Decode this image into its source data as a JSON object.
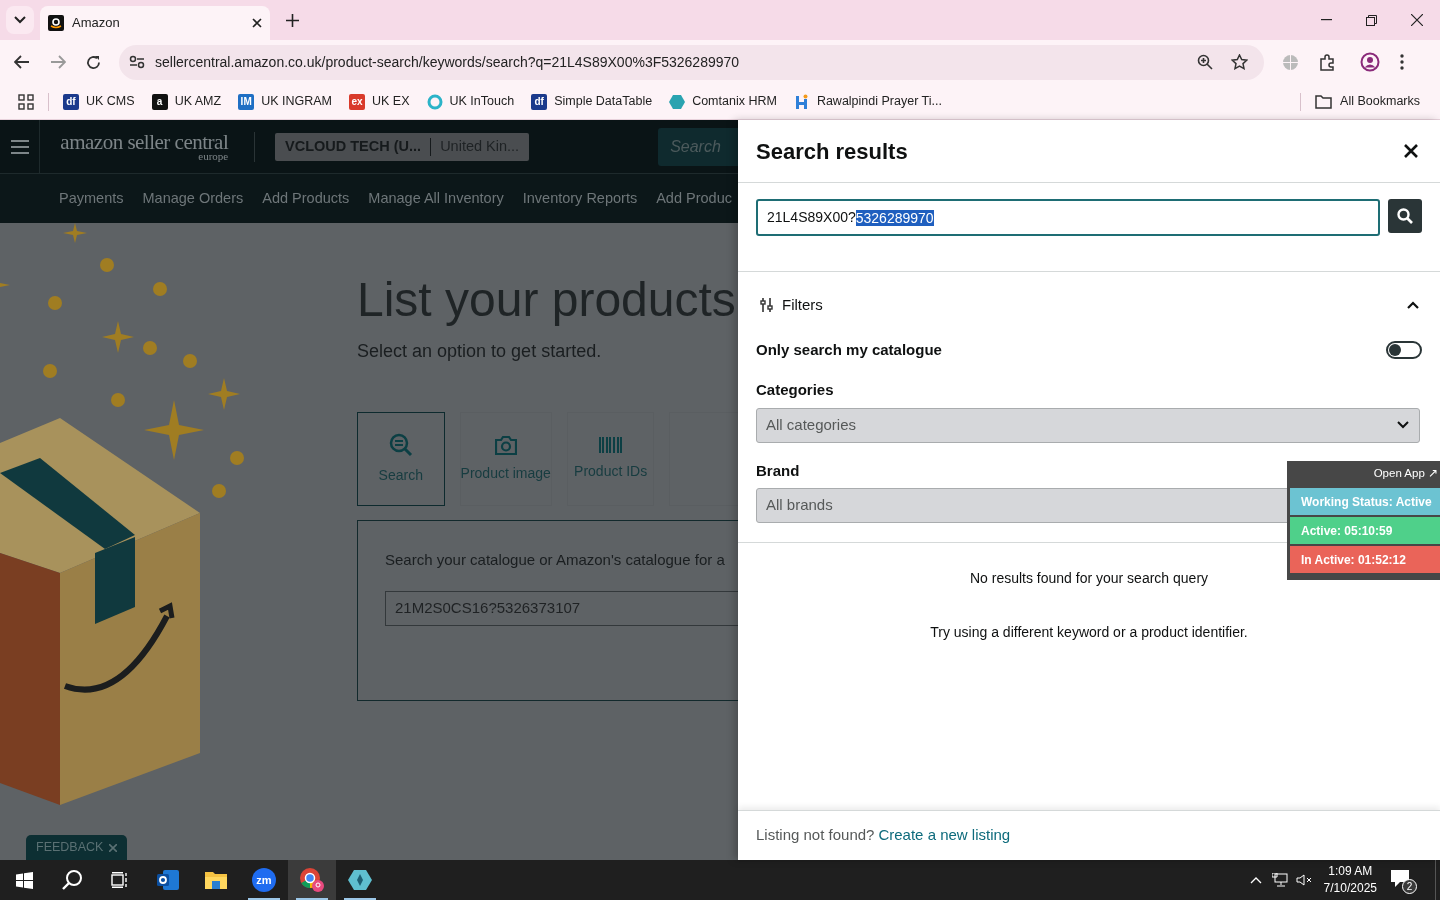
{
  "browser": {
    "tabs": [
      {
        "title": "Amazon",
        "selected": true
      }
    ],
    "url": "sellercentral.amazon.co.uk/product-search/keywords/search?q=21L4S89X00%3F5326289970",
    "bookmarks": [
      {
        "label": "UK CMS",
        "kind": "badge",
        "icon_text": "df",
        "color": "#1b3a8c"
      },
      {
        "label": "UK AMZ",
        "kind": "badge",
        "icon_text": "a",
        "color": "#111111"
      },
      {
        "label": "UK INGRAM",
        "kind": "badge",
        "icon_text": "IM",
        "color": "#1f6fc4"
      },
      {
        "label": "UK EX",
        "kind": "badge",
        "icon_text": "ex",
        "color": "#d93a2b"
      },
      {
        "label": "UK InTouch",
        "kind": "ring",
        "color": "#2bb3c8"
      },
      {
        "label": "Simple DataTable",
        "kind": "badge",
        "icon_text": "df",
        "color": "#1b3a8c"
      },
      {
        "label": "Comtanix HRM",
        "kind": "hex",
        "color": "#2aa3b0"
      },
      {
        "label": "Rawalpindi Prayer Ti...",
        "kind": "figure",
        "color": "#2f7fd8"
      }
    ],
    "all_bookmarks": "All Bookmarks"
  },
  "seller_header": {
    "logo": "amazon seller central",
    "logo_region": "europe",
    "account": "VCLOUD TECH (U...",
    "marketplace": "United Kin...",
    "search_placeholder": "Search"
  },
  "nav": [
    "Payments",
    "Manage Orders",
    "Add Products",
    "Manage All Inventory",
    "Inventory Reports",
    "Add Produc"
  ],
  "page": {
    "title": "List your products",
    "subtitle": "Select an option to get started.",
    "options": [
      {
        "label": "Search",
        "kind": "search",
        "selected": true
      },
      {
        "label": "Product image",
        "kind": "camera",
        "selected": false
      },
      {
        "label": "Product IDs",
        "kind": "barcode",
        "selected": false
      }
    ],
    "prompt": "Search your catalogue or Amazon's catalogue for a",
    "query": "21M2S0CS16?5326373107"
  },
  "feedback": "FEEDBACK",
  "panel": {
    "title": "Search results",
    "search": {
      "value": "21L4S89X00?",
      "selected_value": "5326289970"
    },
    "filters": {
      "label": "Filters",
      "expanded": true,
      "only_my_catalogue": {
        "label": "Only search my catalogue",
        "on": false
      },
      "categories": {
        "label": "Categories",
        "value": "All categories"
      },
      "brand": {
        "label": "Brand",
        "value": "All brands"
      }
    },
    "empty_title": "No results found for your search query",
    "empty_hint": "Try using a different keyword or a product identifier.",
    "footer": {
      "text": "Listing not found?",
      "link": "Create a new listing"
    }
  },
  "time_tracker": {
    "open_app": "Open App ↗",
    "rows": [
      {
        "text": "Working Status: Active",
        "color": "#6cc3d2"
      },
      {
        "text": "Active: 05:10:59",
        "color": "#4fd08a"
      },
      {
        "text": "In Active: 01:52:12",
        "color": "#ea6459"
      }
    ]
  },
  "taskbar": {
    "apps": [
      {
        "kind": "start",
        "running": false,
        "selected": false
      },
      {
        "kind": "search",
        "running": false,
        "selected": false
      },
      {
        "kind": "taskview",
        "running": false,
        "selected": false
      },
      {
        "kind": "outlook",
        "running": false,
        "selected": false
      },
      {
        "kind": "explorer",
        "running": false,
        "selected": false
      },
      {
        "kind": "zoom",
        "icon_text": "zm",
        "running": true,
        "selected": false
      },
      {
        "kind": "chrome",
        "running": true,
        "selected": true
      },
      {
        "kind": "app",
        "running": true,
        "selected": false
      }
    ],
    "time": "1:09 AM",
    "date": "7/10/2025",
    "notifications": "2"
  }
}
